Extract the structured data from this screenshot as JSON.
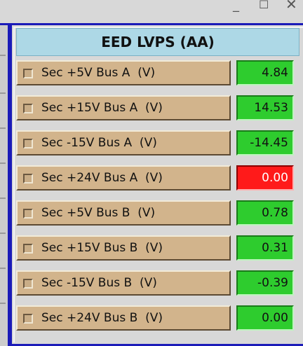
{
  "window_controls": {
    "minimize": "_",
    "maximize": "☐",
    "close": "✕"
  },
  "panel": {
    "title": "EED LVPS (AA)",
    "title_bg": "#add8e6",
    "rows": [
      {
        "label": "Sec +5V Bus A  (V)",
        "value": "4.84",
        "status": "ok"
      },
      {
        "label": "Sec +15V Bus A  (V)",
        "value": "14.53",
        "status": "ok"
      },
      {
        "label": "Sec -15V Bus A  (V)",
        "value": "-14.45",
        "status": "ok"
      },
      {
        "label": "Sec +24V Bus A  (V)",
        "value": "0.00",
        "status": "alarm"
      },
      {
        "label": "Sec +5V Bus B  (V)",
        "value": "0.78",
        "status": "ok"
      },
      {
        "label": "Sec +15V Bus B  (V)",
        "value": "0.31",
        "status": "ok"
      },
      {
        "label": "Sec -15V Bus B  (V)",
        "value": "-0.39",
        "status": "ok"
      },
      {
        "label": "Sec +24V Bus B  (V)",
        "value": "0.00",
        "status": "ok"
      }
    ]
  },
  "colors": {
    "ok": "#2ecc2e",
    "alarm": "#ff1a1a",
    "label_bg": "#d2b48c",
    "frame": "#1b1bb8"
  },
  "icons": {
    "row_checkbox": "square-checkbox-icon"
  }
}
